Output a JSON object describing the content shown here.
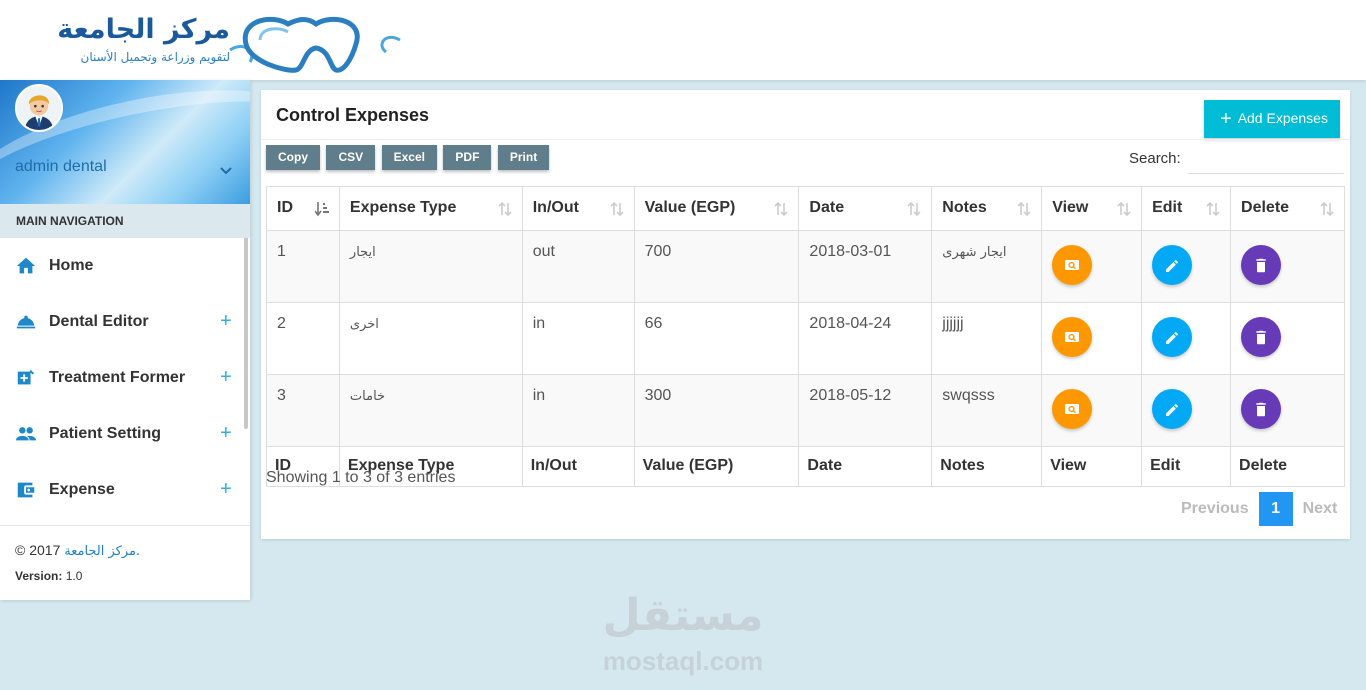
{
  "brand": {
    "logo_title": "مركز الجامعة",
    "logo_subtitle": "لتقويم وزراعة وتجميل الأسنان"
  },
  "user": {
    "name": "admin dental"
  },
  "nav": {
    "header": "MAIN NAVIGATION",
    "items": [
      {
        "label": "Home",
        "icon": "home-icon",
        "expandable": false
      },
      {
        "label": "Dental Editor",
        "icon": "dish-icon",
        "expandable": true,
        "toggle": "+"
      },
      {
        "label": "Treatment Former",
        "icon": "medical-add-icon",
        "expandable": true,
        "toggle": "+"
      },
      {
        "label": "Patient Setting",
        "icon": "people-icon",
        "expandable": true,
        "toggle": "+"
      },
      {
        "label": "Expense",
        "icon": "wallet-icon",
        "expandable": true,
        "toggle": "+"
      }
    ]
  },
  "footer": {
    "copyright": "© 2017",
    "brand_link": "مركز الجامعة",
    "period": ".",
    "version_label": "Version:",
    "version": "1.0"
  },
  "page": {
    "title": "Control Expenses",
    "add_button": "Add Expenses",
    "add_icon": "+",
    "export_buttons": [
      "Copy",
      "CSV",
      "Excel",
      "PDF",
      "Print"
    ],
    "search_label": "Search:",
    "search_value": ""
  },
  "table": {
    "columns": [
      "ID",
      "Expense Type",
      "In/Out",
      "Value (EGP)",
      "Date",
      "Notes",
      "View",
      "Edit",
      "Delete"
    ],
    "rows": [
      {
        "id": "1",
        "type": "ايجار",
        "inout": "out",
        "value": "700",
        "date": "2018-03-01",
        "notes": "ايجار شهرى"
      },
      {
        "id": "2",
        "type": "اخرى",
        "inout": "in",
        "value": "66",
        "date": "2018-04-24",
        "notes": "jjjjjj"
      },
      {
        "id": "3",
        "type": "خامات",
        "inout": "in",
        "value": "300",
        "date": "2018-05-12",
        "notes": "swqsss"
      }
    ],
    "info": "Showing 1 to 3 of 3 entries",
    "pagination": {
      "previous": "Previous",
      "current": "1",
      "next": "Next"
    }
  },
  "watermark": {
    "arabic": "مستقل",
    "latin": "mostaql.com"
  },
  "colors": {
    "accent": "#00bcd4",
    "view": "#ff9800",
    "edit": "#03a9f4",
    "delete": "#673ab7",
    "export": "#607d8b",
    "page_bg": "#d5e8ef"
  }
}
